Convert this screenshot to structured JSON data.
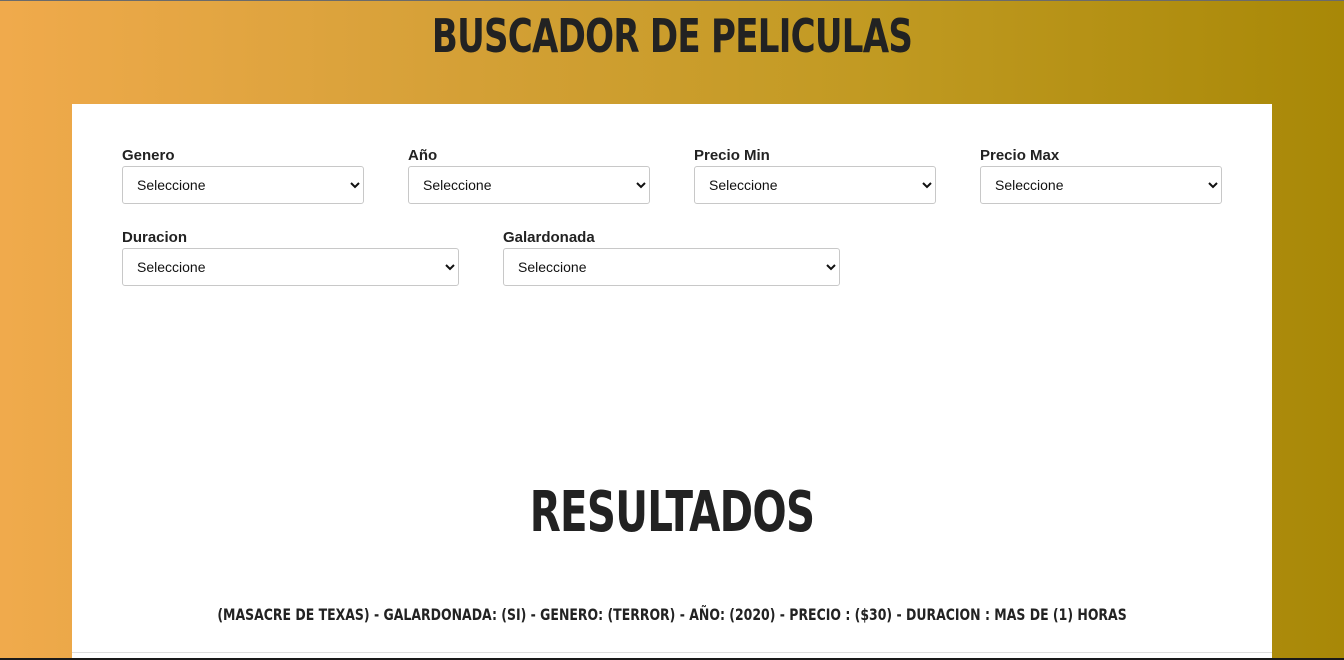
{
  "header": {
    "title": "BUSCADOR DE PELICULAS"
  },
  "filters": [
    {
      "label": "Genero",
      "selected": "Seleccione"
    },
    {
      "label": "Año",
      "selected": "Seleccione"
    },
    {
      "label": "Precio Min",
      "selected": "Seleccione"
    },
    {
      "label": "Precio Max",
      "selected": "Seleccione"
    },
    {
      "label": "Duracion",
      "selected": "Seleccione"
    },
    {
      "label": "Galardonada",
      "selected": "Seleccione"
    }
  ],
  "results": {
    "title": "RESULTADOS",
    "items": [
      "(MASACRE DE TEXAS) - GALARDONADA: (SI) - GENERO: (TERROR) - AÑO: (2020) - PRECIO : ($30) - DURACION : MAS DE (1) HORAS"
    ]
  },
  "colors": {
    "gradient_start": "#f0aa4c",
    "gradient_end": "#a88807",
    "text": "#222222",
    "panel": "#ffffff"
  }
}
